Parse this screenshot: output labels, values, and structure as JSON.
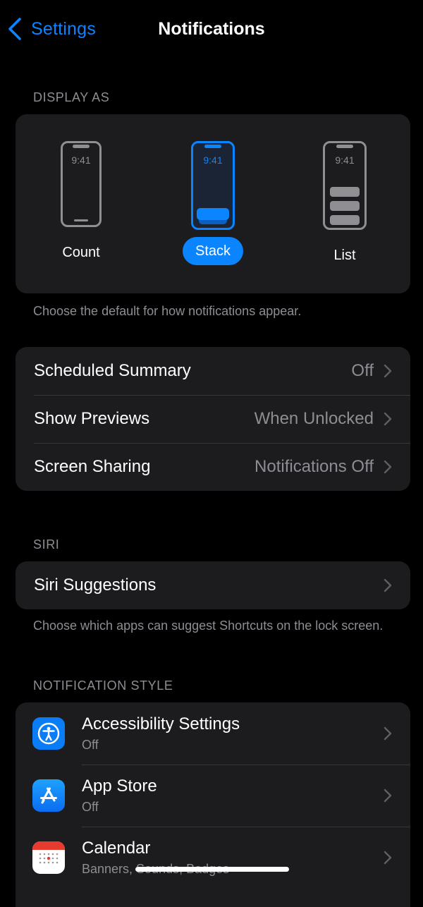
{
  "nav": {
    "back_label": "Settings",
    "title": "Notifications"
  },
  "display_as": {
    "header": "DISPLAY AS",
    "options": [
      {
        "label": "Count",
        "time": "9:41",
        "selected": false
      },
      {
        "label": "Stack",
        "time": "9:41",
        "selected": true
      },
      {
        "label": "List",
        "time": "9:41",
        "selected": false
      }
    ],
    "footnote": "Choose the default for how notifications appear."
  },
  "general_rows": [
    {
      "label": "Scheduled Summary",
      "value": "Off"
    },
    {
      "label": "Show Previews",
      "value": "When Unlocked"
    },
    {
      "label": "Screen Sharing",
      "value": "Notifications Off"
    }
  ],
  "siri": {
    "header": "SIRI",
    "row_label": "Siri Suggestions",
    "footnote": "Choose which apps can suggest Shortcuts on the lock screen."
  },
  "notification_style": {
    "header": "NOTIFICATION STYLE",
    "apps": [
      {
        "name": "Accessibility Settings",
        "status": "Off",
        "icon": "accessibility-icon",
        "color": "#0a7cf5"
      },
      {
        "name": "App Store",
        "status": "Off",
        "icon": "app-store-icon",
        "color": "#1a8cff"
      },
      {
        "name": "Calendar",
        "status": "Banners, Sounds, Badges",
        "icon": "calendar-icon",
        "color": "#ffffff"
      }
    ]
  },
  "colors": {
    "accent": "#0a84ff",
    "background": "#000000",
    "card": "#1c1c1e",
    "secondary_text": "#8d8d93"
  }
}
